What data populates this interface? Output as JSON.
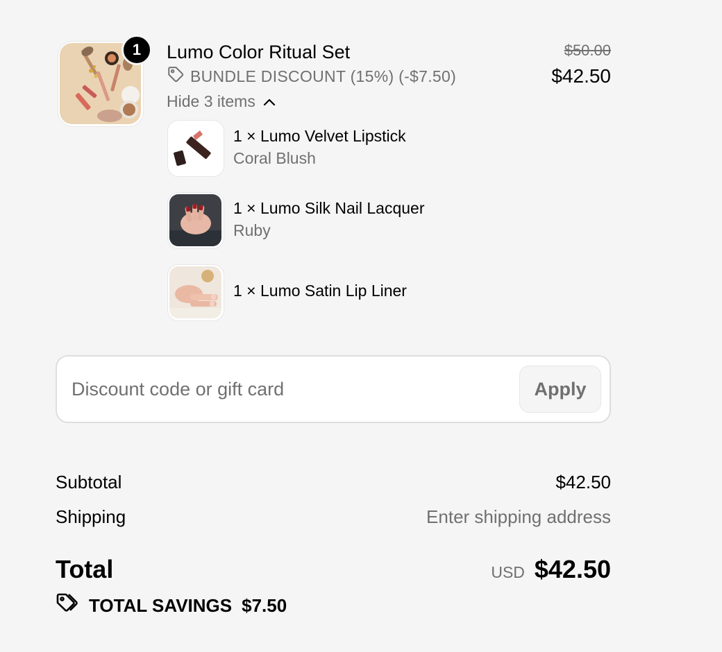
{
  "product": {
    "name": "Lumo Color Ritual Set",
    "quantity": "1",
    "discount_label": "BUNDLE DISCOUNT (15%) (-$7.50)",
    "toggle_label": "Hide 3 items",
    "original_price": "$50.00",
    "price": "$42.50",
    "icons": {
      "discount": "tag-icon",
      "toggle": "chevron-up-icon"
    }
  },
  "bundle_items": [
    {
      "name": "1 × Lumo Velvet Lipstick",
      "variant": "Coral Blush"
    },
    {
      "name": "1 × Lumo Silk Nail Lacquer",
      "variant": "Ruby"
    },
    {
      "name": "1 × Lumo Satin Lip Liner"
    }
  ],
  "discount_form": {
    "placeholder": "Discount code or gift card",
    "value": "",
    "apply_label": "Apply"
  },
  "totals": {
    "subtotal_label": "Subtotal",
    "subtotal_value": "$42.50",
    "shipping_label": "Shipping",
    "shipping_value": "Enter shipping address",
    "total_label": "Total",
    "currency": "USD",
    "total_value": "$42.50",
    "savings_label": "TOTAL SAVINGS",
    "savings_value": "$7.50",
    "savings_icon": "tags-icon"
  },
  "colors": {
    "background": "#f5f5f5",
    "text": "#000000",
    "muted_text": "#707070",
    "border": "#dedede",
    "badge": "#000000"
  }
}
